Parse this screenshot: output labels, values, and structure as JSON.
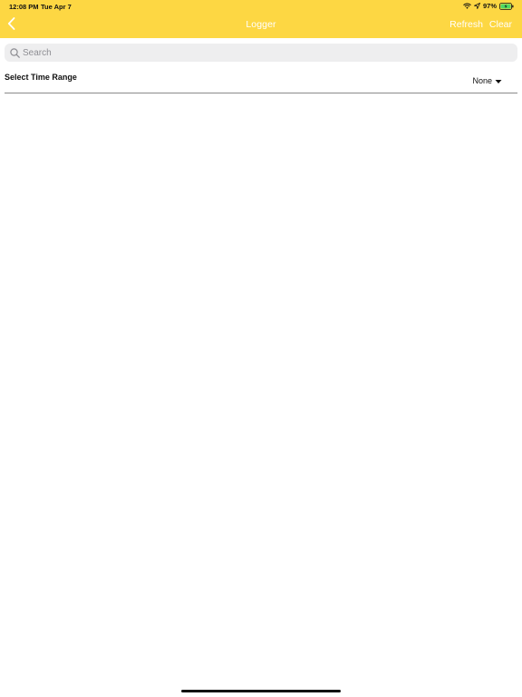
{
  "status_bar": {
    "time": "12:08 PM",
    "date": "Tue Apr 7",
    "battery_percent": "97%",
    "icons": [
      "wifi-icon",
      "location-icon",
      "battery-charging-icon"
    ]
  },
  "nav": {
    "title": "Logger",
    "back_icon": "chevron-left-icon",
    "refresh_label": "Refresh",
    "clear_label": "Clear"
  },
  "search": {
    "placeholder": "Search",
    "value": ""
  },
  "time_range": {
    "label": "Select Time Range",
    "selected": "None",
    "dropdown_icon": "caret-down-icon"
  },
  "colors": {
    "header_bg": "#fdd743",
    "header_text": "#ffffff",
    "search_bg": "#eeeeef",
    "battery_fill": "#4cd964"
  }
}
